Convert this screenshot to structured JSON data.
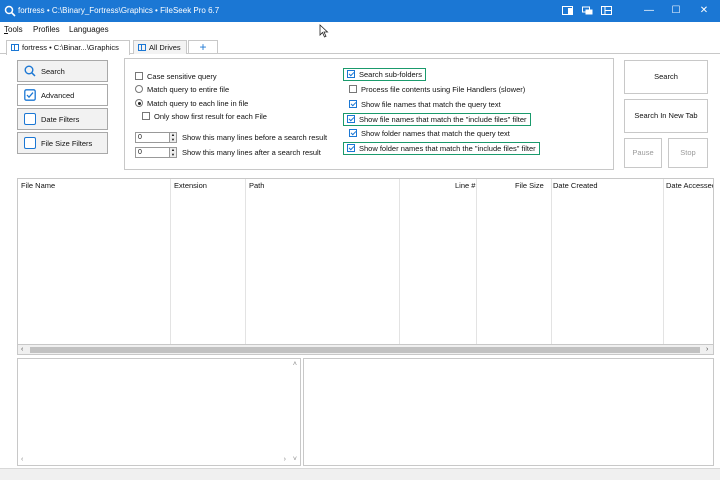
{
  "window": {
    "title": "fortress • C:\\Binary_Fortress\\Graphics • FileSeek Pro 6.7",
    "controls": {
      "minimize": "—",
      "maximize": "☐",
      "close": "✕"
    },
    "accent_color": "#1b77d4"
  },
  "menu": {
    "items": [
      "Tools",
      "Profiles",
      "Languages"
    ]
  },
  "tabs": [
    {
      "label": "fortress • C:\\Binar...\\Graphics",
      "active": true
    },
    {
      "label": "All Drives",
      "active": false
    }
  ],
  "tab_add_label": "+",
  "nav": {
    "items": [
      {
        "label": "Search",
        "icon": "magnifier-icon"
      },
      {
        "label": "Advanced",
        "icon": "checkbox-icon"
      },
      {
        "label": "Date Filters",
        "icon": "blank-box-icon"
      },
      {
        "label": "File Size Filters",
        "icon": "blank-box-icon"
      }
    ],
    "selected": "Advanced"
  },
  "options": {
    "case_sensitive": {
      "label": "Case sensitive query",
      "checked": false
    },
    "match_entire_file": {
      "label": "Match query to entire file",
      "selected": false
    },
    "match_each_line": {
      "label": "Match query to each line in file",
      "selected": true
    },
    "only_first_result": {
      "label": "Only show first result for each File",
      "checked": false
    },
    "lines_before": {
      "value": "0",
      "label": "Show this many lines before a search result"
    },
    "lines_after": {
      "value": "0",
      "label": "Show this many lines after a search result"
    },
    "search_subfolders": {
      "label": "Search sub-folders",
      "checked": true
    },
    "process_file_handlers": {
      "label": "Process file contents using File Handlers (slower)",
      "checked": false
    },
    "show_file_names_query": {
      "label": "Show file names that match the query text",
      "checked": true
    },
    "show_file_names_include": {
      "label": "Show file names that match the \"include files\" filter",
      "checked": true
    },
    "show_folder_names_query": {
      "label": "Show folder names that match the query text",
      "checked": true
    },
    "show_folder_names_include": {
      "label": "Show folder names that match the \"include files\" filter",
      "checked": true
    },
    "highlight_color": "#1a9a6c"
  },
  "actions": {
    "search": "Search",
    "search_new_tab": "Search In New Tab",
    "pause": "Pause",
    "stop": "Stop"
  },
  "results": {
    "columns": [
      "File Name",
      "Extension",
      "Path",
      "Line #",
      "File Size",
      "Date Created",
      "Date Accessed"
    ]
  },
  "scroll": {
    "left": "‹",
    "right": "›",
    "up": "˄",
    "down": "˅"
  }
}
